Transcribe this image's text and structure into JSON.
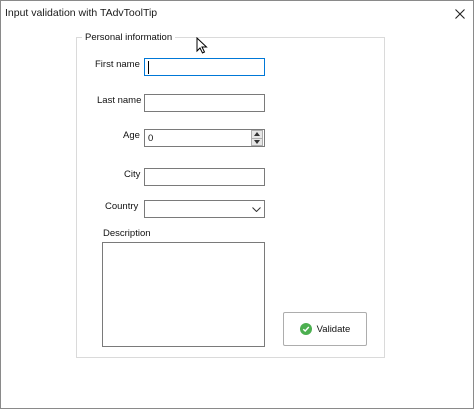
{
  "window": {
    "title": "Input validation with TAdvToolTip"
  },
  "group": {
    "title": "Personal information"
  },
  "fields": {
    "first_name": {
      "label": "First name",
      "value": ""
    },
    "last_name": {
      "label": "Last name",
      "value": ""
    },
    "age": {
      "label": "Age",
      "value": "0"
    },
    "city": {
      "label": "City",
      "value": ""
    },
    "country": {
      "label": "Country",
      "value": ""
    },
    "description": {
      "label": "Description",
      "value": ""
    }
  },
  "buttons": {
    "validate_label": "Validate"
  },
  "colors": {
    "focus_border": "#0078d7",
    "check_green": "#4caf50"
  },
  "icons": {
    "close": "close-icon",
    "validate": "check-circle-icon",
    "spin_up": "arrow-up-icon",
    "spin_down": "arrow-down-icon",
    "combo": "chevron-down-icon",
    "pointer": "mouse-pointer-icon"
  }
}
